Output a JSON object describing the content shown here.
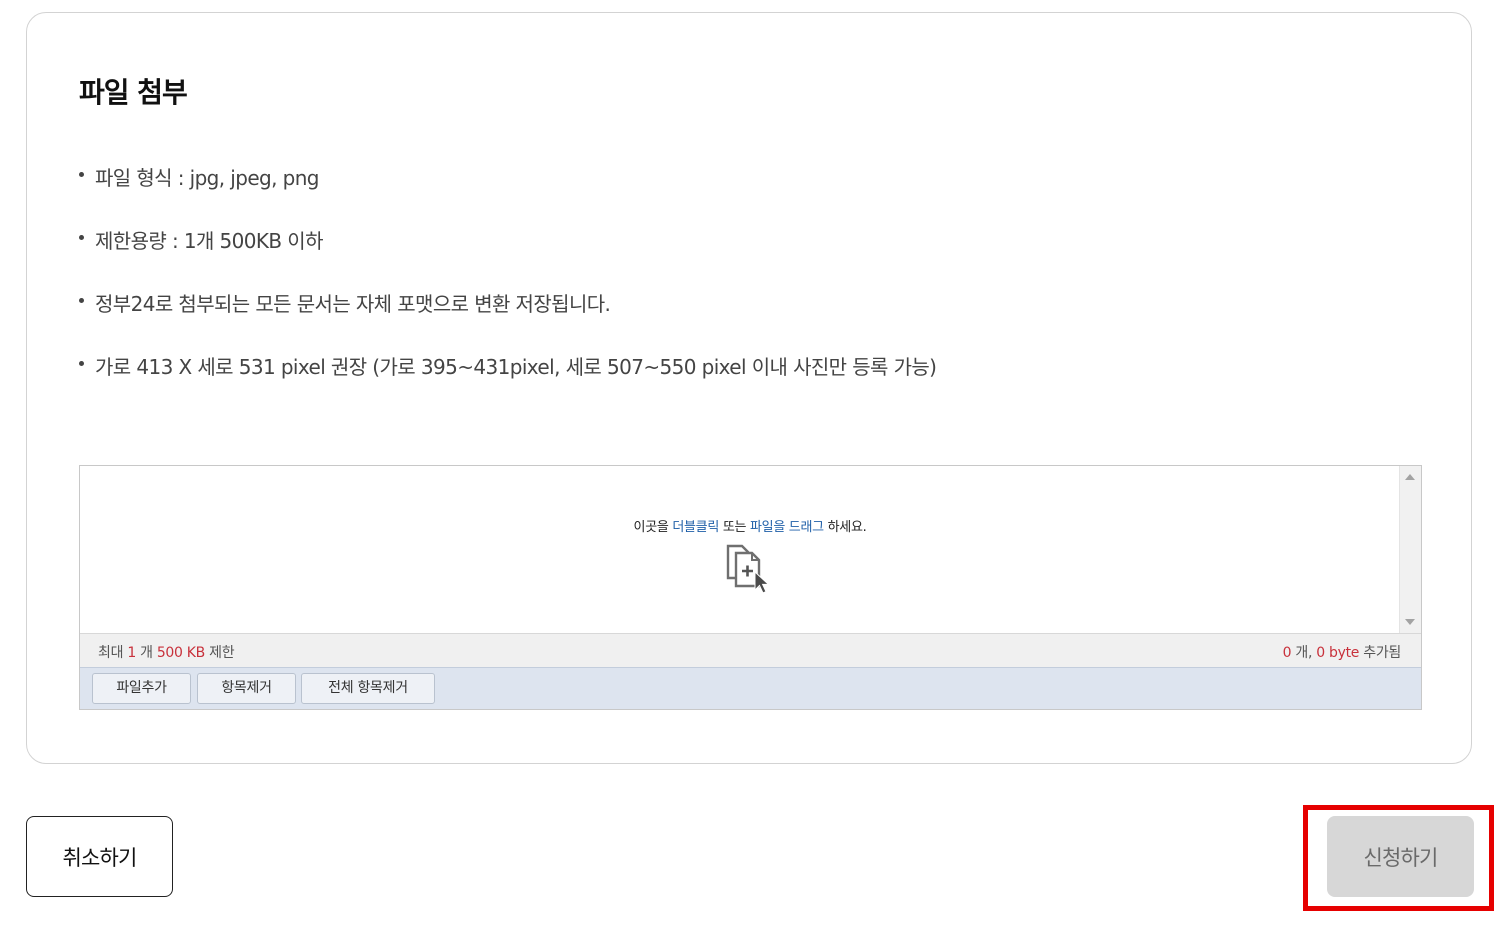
{
  "section": {
    "title": "파일 첨부"
  },
  "guide": {
    "items": [
      "파일 형식 : jpg, jpeg, png",
      "제한용량 : 1개 500KB 이하",
      "정부24로 첨부되는 모든 문서는 자체 포맷으로 변환 저장됩니다.",
      "가로 413 X 세로 531 pixel 권장 (가로 395~431pixel, 세로 507~550 pixel 이내 사진만 등록 가능)"
    ]
  },
  "uploader": {
    "hint": {
      "prefix": "이곳을 ",
      "double_click": "더블클릭",
      "middle": " 또는 ",
      "drag": "파일을 드래그",
      "suffix": " 하세요."
    },
    "icon": "file-add-cursor-icon",
    "limit": {
      "prefix": "최대 ",
      "count": "1",
      "count_unit": " 개 ",
      "size": "500 KB",
      "suffix": " 제한"
    },
    "added": {
      "count": "0",
      "count_unit": " 개, ",
      "bytes": "0 byte",
      "suffix": " 추가됨"
    },
    "buttons": {
      "add_file": "파일추가",
      "remove_item": "항목제거",
      "remove_all": "전체 항목제거"
    }
  },
  "footer": {
    "cancel_label": "취소하기",
    "apply_label": "신청하기"
  },
  "colors": {
    "link": "#1f5fa8",
    "limit_red": "#c8313b",
    "highlight": "#e60000",
    "apply_disabled_bg": "#d7d7d7"
  }
}
